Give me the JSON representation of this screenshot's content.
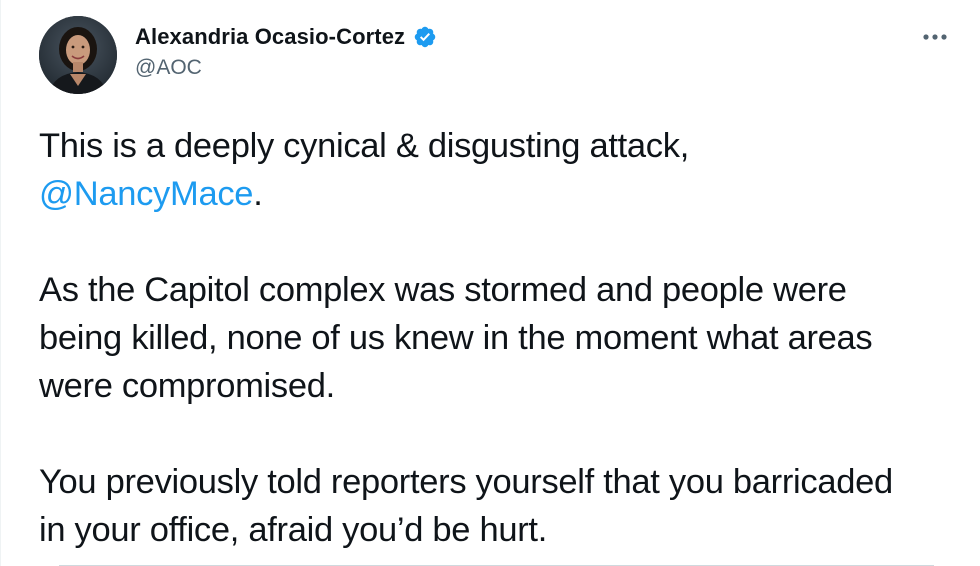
{
  "author": {
    "display_name": "Alexandria Ocasio-Cortez",
    "handle": "@AOC",
    "verified": true,
    "avatar_icon": "profile-photo"
  },
  "more_icon": "more-horizontal-icon",
  "tweet": {
    "line1_text": "This is a deeply cynical & disgusting attack,",
    "mention": "@NancyMace",
    "mention_suffix": ".",
    "para2_line1": "As the Capitol complex was stormed and people were",
    "para2_line2": "being killed, none of us knew in the moment what areas",
    "para2_line3": "were compromised.",
    "para3_line1": "You previously told reporters yourself that you barricaded",
    "para3_line2": "in your office, afraid you’d be hurt."
  },
  "colors": {
    "text": "#0f1419",
    "secondary": "#536471",
    "link": "#1d9bf0",
    "verified": "#1d9bf0"
  }
}
